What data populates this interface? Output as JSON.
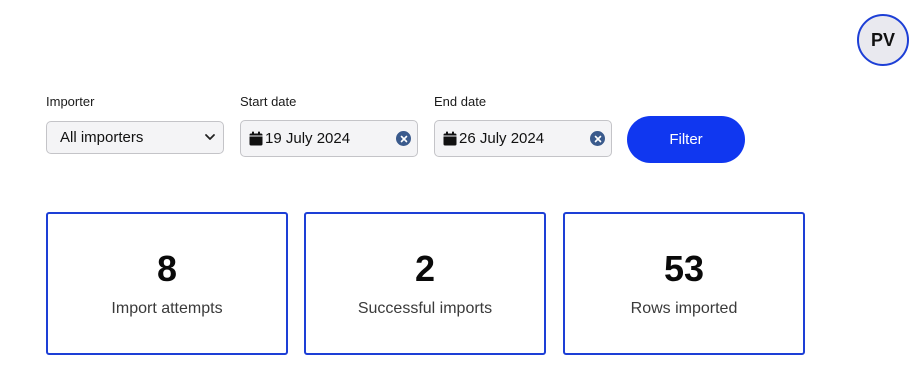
{
  "user": {
    "initials": "PV"
  },
  "filters": {
    "importer": {
      "label": "Importer",
      "selected": "All importers"
    },
    "start_date": {
      "label": "Start date",
      "value": "19 July 2024"
    },
    "end_date": {
      "label": "End date",
      "value": "26 July 2024"
    },
    "filter_button": "Filter"
  },
  "stats": [
    {
      "value": "8",
      "label": "Import attempts"
    },
    {
      "value": "2",
      "label": "Successful imports"
    },
    {
      "value": "53",
      "label": "Rows imported"
    }
  ],
  "colors": {
    "accent": "#1037f0",
    "card_border": "#1d3fd6",
    "clear_icon": "#3a5a8c"
  },
  "icons": {
    "select_arrow": "chevron-down-icon",
    "date_picker": "calendar-icon",
    "clear": "clear-icon"
  }
}
